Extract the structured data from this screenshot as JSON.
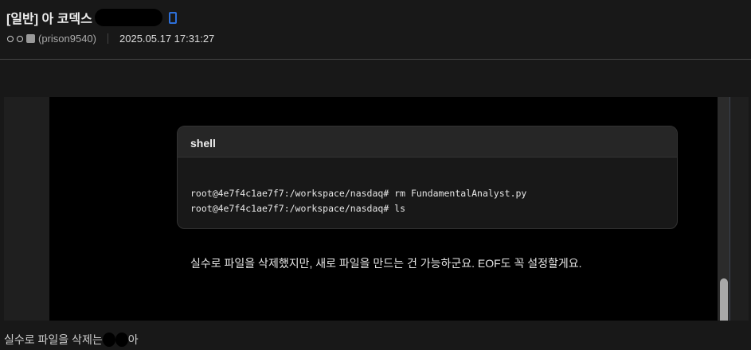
{
  "post": {
    "title": "[일반] 아 코덱스",
    "author_id": "(prison9540)",
    "date": "2025.05.17 17:31:27"
  },
  "screenshot": {
    "code_lang": "shell",
    "code_lines": [
      "root@4e7f4c1ae7f7:/workspace/nasdaq# rm FundamentalAnalyst.py",
      "root@4e7f4c1ae7f7:/workspace/nasdaq# ls"
    ],
    "message": "실수로 파일을 삭제했지만, 새로 파일을 만드는 건 가능하군요. EOF도 꼭 설정할게요."
  },
  "caption": {
    "before": "실수로 파일을 삭제는 ",
    "after": "아"
  }
}
